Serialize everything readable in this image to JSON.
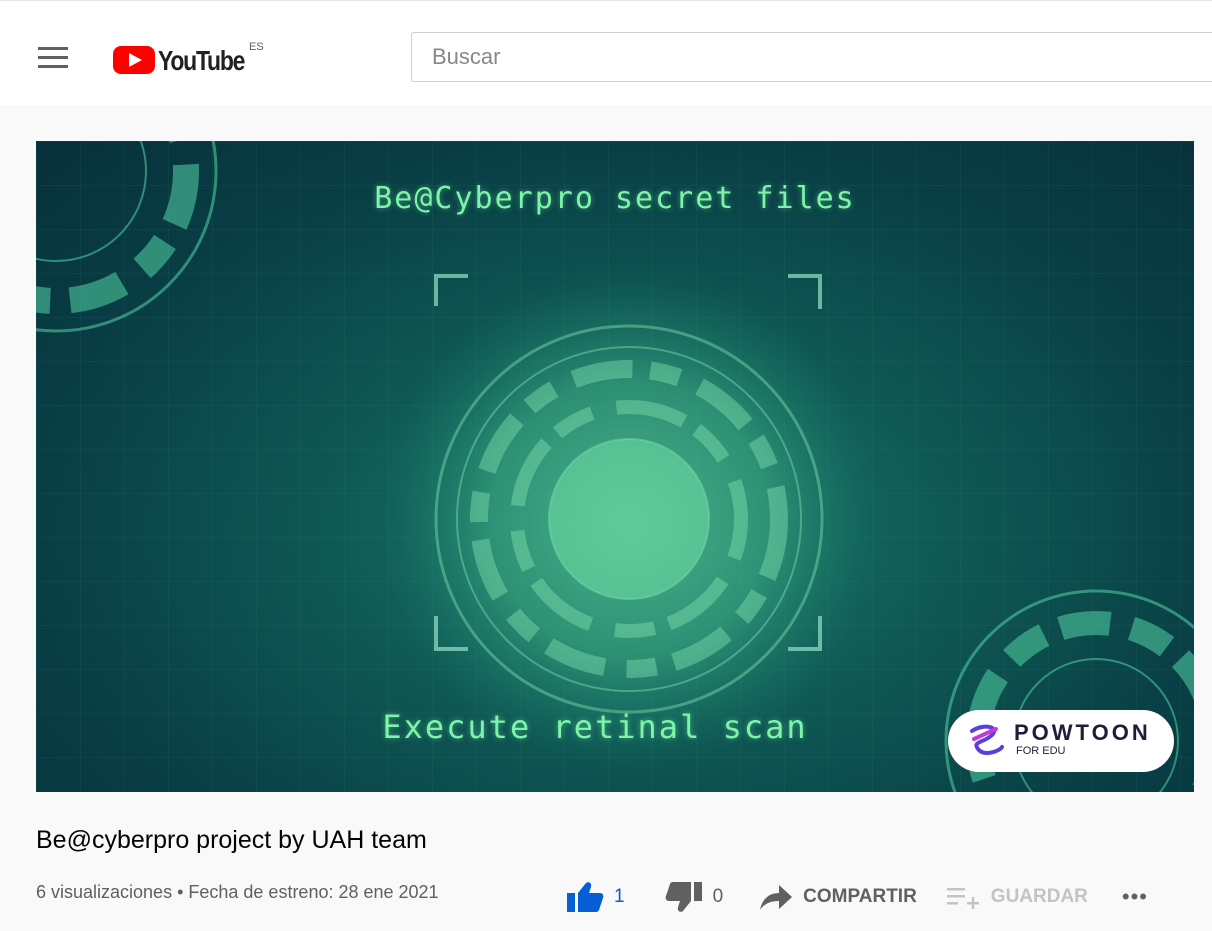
{
  "header": {
    "logo_text": "YouTube",
    "logo_country": "ES",
    "search_placeholder": "Buscar"
  },
  "video": {
    "overlay_top": "Be@Cyberpro secret files",
    "overlay_bottom": "Execute retinal scan",
    "watermark_name": "POWTOON",
    "watermark_sub": "FOR EDU"
  },
  "info": {
    "title": "Be@cyberpro project by UAH team",
    "meta": "6 visualizaciones • Fecha de estreno: 28 ene 2021",
    "likes": "1",
    "dislikes": "0",
    "share_label": "COMPARTIR",
    "save_label": "GUARDAR",
    "more_label": "•••"
  },
  "colors": {
    "brand_red": "#ff0000",
    "like_blue": "#065fd4",
    "scan_green": "#7df5a8"
  }
}
